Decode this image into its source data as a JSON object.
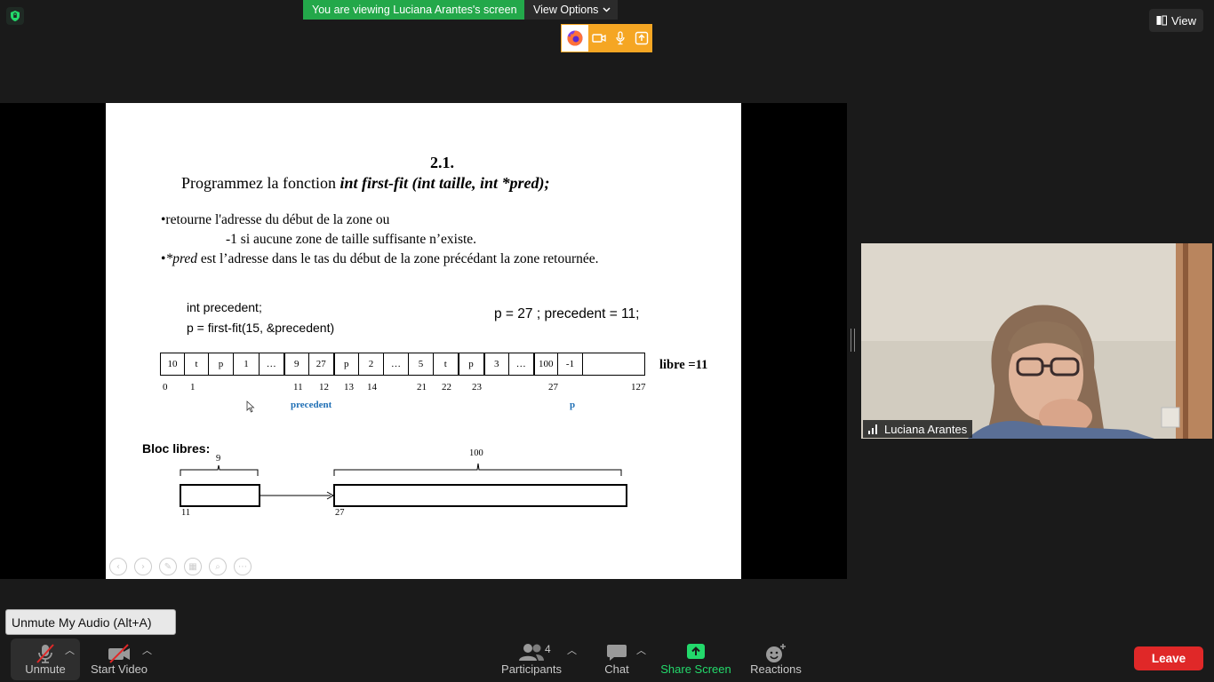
{
  "banner": {
    "viewing_text": "You are viewing Luciana Arantes's screen",
    "view_options_label": "View Options",
    "view_label": "View"
  },
  "colors": {
    "banner_green": "#23a84a",
    "toolbar_orange": "#f5a623",
    "leave_red": "#e02828",
    "share_green": "#23d96b",
    "slide_blue": "#1f6fb5"
  },
  "share_toolbar": {
    "icons": [
      "firefox-icon",
      "video-camera-icon",
      "microphone-icon",
      "share-up-icon"
    ]
  },
  "slide": {
    "number": "2.1.",
    "heading_prefix": "Programmez la fonction ",
    "heading_signature": "int  first-fit (int taille, int *pred);",
    "bullet1_line1": "•retourne  l'adresse du début de la zone ou",
    "bullet1_line2": "-1 si aucune zone de taille suffisante n’existe.",
    "bullet2_star": "•",
    "bullet2_pred": "*pred",
    "bullet2_rest": " est l’adresse dans le tas du début de la zone précédant la zone retournée.",
    "code_line1": "int precedent;",
    "code_line2": "p = first-fit(15, &precedent)",
    "result": "p = 27 ; precedent = 11;",
    "memory_cells": [
      "10",
      "t",
      "p",
      "1",
      "…",
      "9",
      "27",
      "p",
      "2",
      "…",
      "5",
      "t",
      "p",
      "3",
      "…",
      "100",
      "-1",
      ""
    ],
    "libre_label": "libre =11",
    "indices": [
      "0",
      "1",
      "11",
      "12",
      "13",
      "14",
      "21",
      "22",
      "23",
      "27",
      "127"
    ],
    "precedent_label": "precedent",
    "p_label": "p",
    "bloc_title": "Bloc libres:",
    "bloc1_size": "9",
    "bloc1_addr": "11",
    "bloc2_size": "100",
    "bloc2_addr": "27"
  },
  "participant": {
    "name": "Luciana Arantes"
  },
  "tooltip": "Unmute My Audio (Alt+A)",
  "toolbar": {
    "unmute_label": "Unmute",
    "video_label": "Start Video",
    "participants_label": "Participants",
    "participants_count": "4",
    "chat_label": "Chat",
    "share_label": "Share Screen",
    "reactions_label": "Reactions",
    "leave_label": "Leave"
  }
}
